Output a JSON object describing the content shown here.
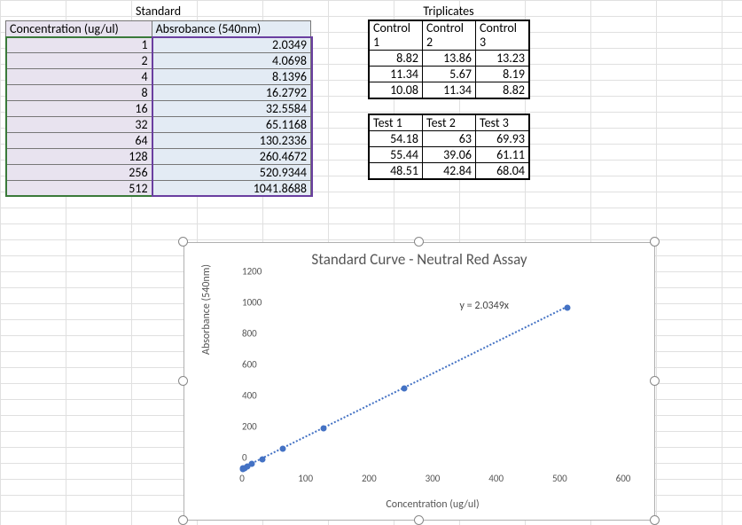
{
  "standard": {
    "title": "Standard",
    "headers": [
      "Concentration (ug/ul)",
      "Absrobance (540nm)"
    ],
    "rows": [
      [
        1,
        2.0349
      ],
      [
        2,
        4.0698
      ],
      [
        4,
        8.1396
      ],
      [
        8,
        16.2792
      ],
      [
        16,
        32.5584
      ],
      [
        32,
        65.1168
      ],
      [
        64,
        130.2336
      ],
      [
        128,
        260.4672
      ],
      [
        256,
        520.9344
      ],
      [
        512,
        1041.8688
      ]
    ]
  },
  "triplicates": {
    "title": "Triplicates",
    "control": {
      "headers": [
        "Control 1",
        "Control 2",
        "Control 3"
      ],
      "rows": [
        [
          8.82,
          13.86,
          13.23
        ],
        [
          11.34,
          5.67,
          8.19
        ],
        [
          10.08,
          11.34,
          8.82
        ]
      ]
    },
    "test": {
      "headers": [
        "Test 1",
        "Test 2",
        "Test 3"
      ],
      "rows": [
        [
          54.18,
          63,
          69.93
        ],
        [
          55.44,
          39.06,
          61.11
        ],
        [
          48.51,
          42.84,
          68.04
        ]
      ]
    }
  },
  "chart_data": {
    "type": "scatter",
    "title": "Standard Curve - Neutral Red Assay",
    "xlabel": "Concentration (ug/ul)",
    "ylabel": "Absorbance (540nm)",
    "xlim": [
      0,
      600
    ],
    "ylim": [
      0,
      1200
    ],
    "x_ticks": [
      0,
      100,
      200,
      300,
      400,
      500,
      600
    ],
    "y_ticks": [
      0,
      200,
      400,
      600,
      800,
      1000,
      1200
    ],
    "series": [
      {
        "name": "Standard",
        "x": [
          1,
          2,
          4,
          8,
          16,
          32,
          64,
          128,
          256,
          512
        ],
        "y": [
          2.0349,
          4.0698,
          8.1396,
          16.2792,
          32.5584,
          65.1168,
          130.2336,
          260.4672,
          520.9344,
          1041.8688
        ]
      }
    ],
    "trendline": {
      "equation": "y = 2.0349x"
    }
  }
}
